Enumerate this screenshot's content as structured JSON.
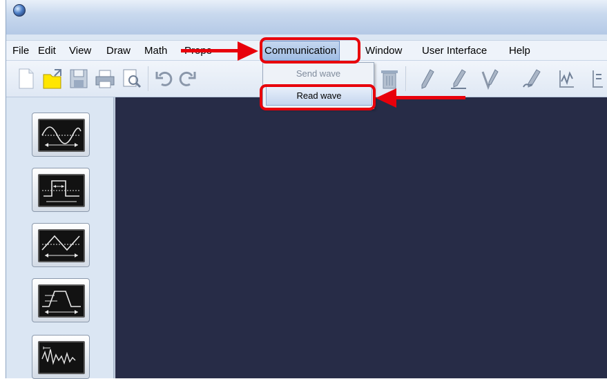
{
  "menu": {
    "file": "File",
    "edit": "Edit",
    "view": "View",
    "draw": "Draw",
    "math": "Math",
    "properties_partial": "Prope",
    "communication": "Communication",
    "window": "Window",
    "user_interface": "User Interface",
    "help": "Help"
  },
  "dropdown": {
    "send_wave": "Send wave",
    "read_wave": "Read wave"
  },
  "waveforms": [
    "sine-wave",
    "square-wave",
    "triangle-wave",
    "trapezoid-wave",
    "arbitrary-wave"
  ],
  "colors": {
    "canvas": "#272c47",
    "highlight": "#e8000b",
    "menubar": "#eef3fa",
    "sidebar": "#dbe6f3"
  }
}
